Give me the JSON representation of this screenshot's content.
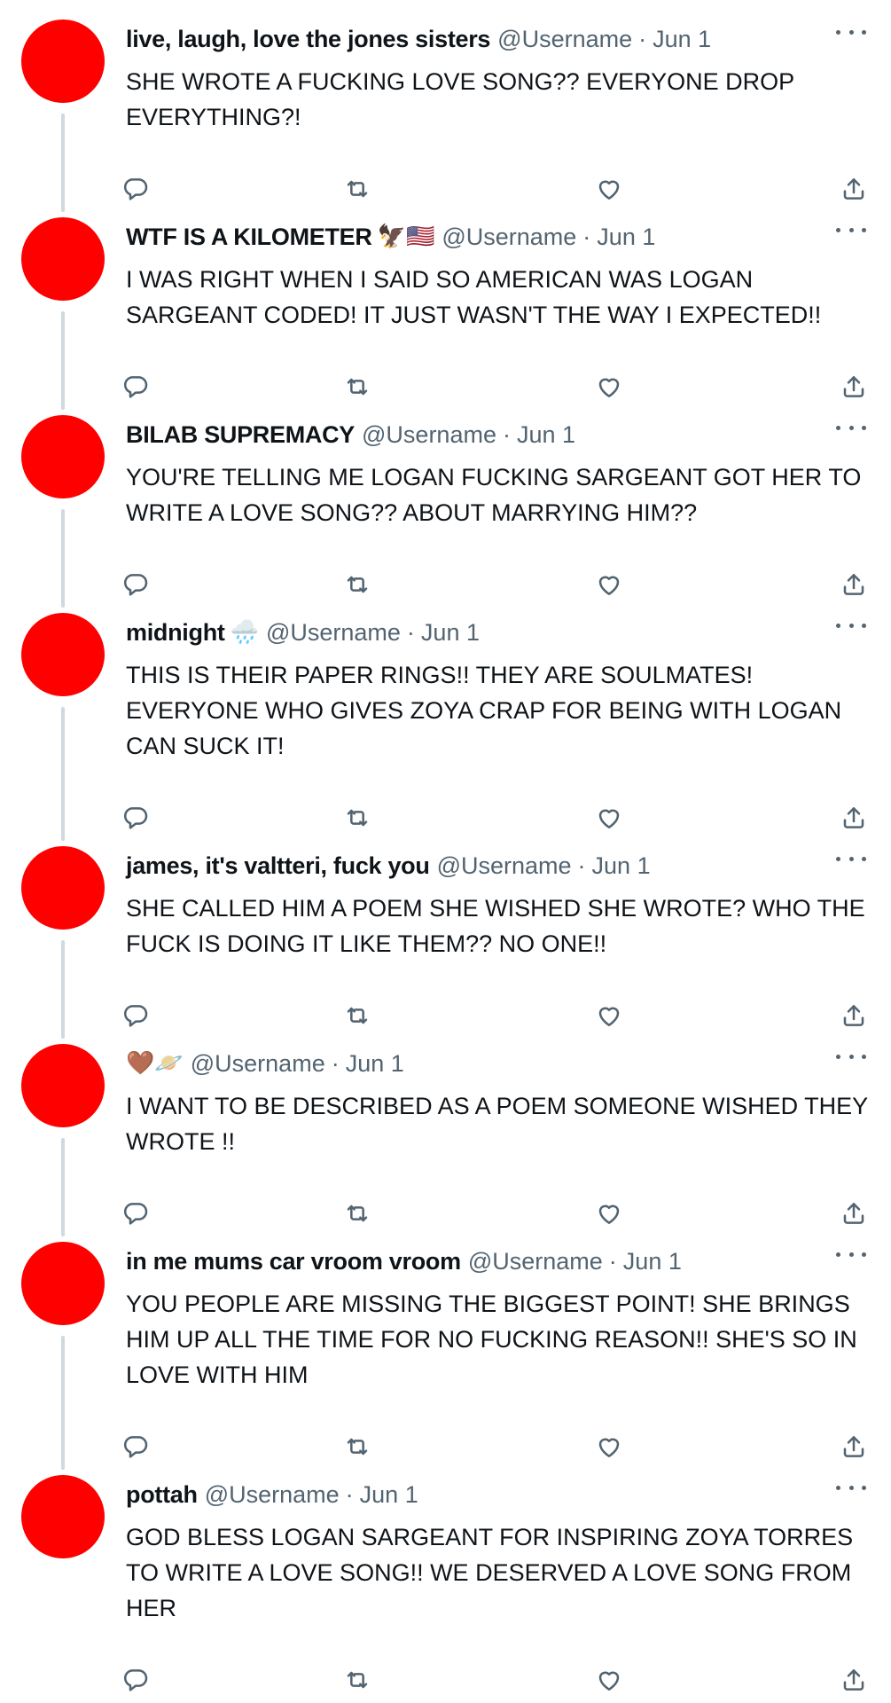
{
  "icons": {
    "reply": "reply-icon",
    "retweet": "retweet-icon",
    "like": "heart-icon",
    "share": "share-icon",
    "more": "more-icon"
  },
  "colors": {
    "avatar": "#ff0000",
    "secondary_text": "#536471",
    "thread_line": "#cfd9de"
  },
  "tweets": [
    {
      "display_name": "live, laugh, love the jones sisters",
      "emojis": "",
      "handle": "@Username",
      "date": "Jun 1",
      "text": "SHE WROTE A FUCKING LOVE SONG?? EVERYONE DROP EVERYTHING?!"
    },
    {
      "display_name": "WTF IS A KILOMETER",
      "emojis": "🦅🇺🇸",
      "handle": "@Username",
      "date": "Jun 1",
      "text": "I WAS RIGHT WHEN I SAID SO AMERICAN WAS LOGAN SARGEANT CODED! IT JUST WASN'T THE WAY I EXPECTED!!"
    },
    {
      "display_name": "BILAB SUPREMACY",
      "emojis": "",
      "handle": "@Username",
      "date": "Jun 1",
      "text": "YOU'RE TELLING ME LOGAN FUCKING SARGEANT GOT HER TO WRITE A LOVE SONG?? ABOUT MARRYING HIM??"
    },
    {
      "display_name": "midnight",
      "emojis": "🌧️",
      "handle": "@Username",
      "date": "Jun 1",
      "text": "THIS IS THEIR PAPER RINGS!! THEY ARE SOULMATES! EVERYONE WHO GIVES ZOYA CRAP FOR BEING WITH LOGAN CAN SUCK IT!"
    },
    {
      "display_name": "james, it's valtteri, fuck you",
      "emojis": "",
      "handle": "@Username",
      "date": "Jun 1",
      "text": "SHE CALLED HIM A POEM SHE WISHED SHE WROTE? WHO THE FUCK IS DOING IT LIKE THEM?? NO ONE!!"
    },
    {
      "display_name": "",
      "emojis": "🤎🪐",
      "handle": "@Username",
      "date": "Jun 1",
      "text": "I WANT TO BE DESCRIBED AS A POEM SOMEONE WISHED THEY WROTE !!"
    },
    {
      "display_name": "in me mums car vroom vroom",
      "emojis": "",
      "handle": "@Username",
      "date": "Jun 1",
      "text": "YOU PEOPLE ARE MISSING THE BIGGEST POINT! SHE BRINGS HIM UP ALL THE TIME FOR NO FUCKING REASON!! SHE'S SO IN LOVE WITH HIM"
    },
    {
      "display_name": "pottah",
      "emojis": "",
      "handle": "@Username",
      "date": "Jun 1",
      "text": "GOD BLESS LOGAN SARGEANT FOR INSPIRING ZOYA TORRES TO WRITE A LOVE SONG!! WE DESERVED A LOVE SONG FROM HER"
    }
  ]
}
